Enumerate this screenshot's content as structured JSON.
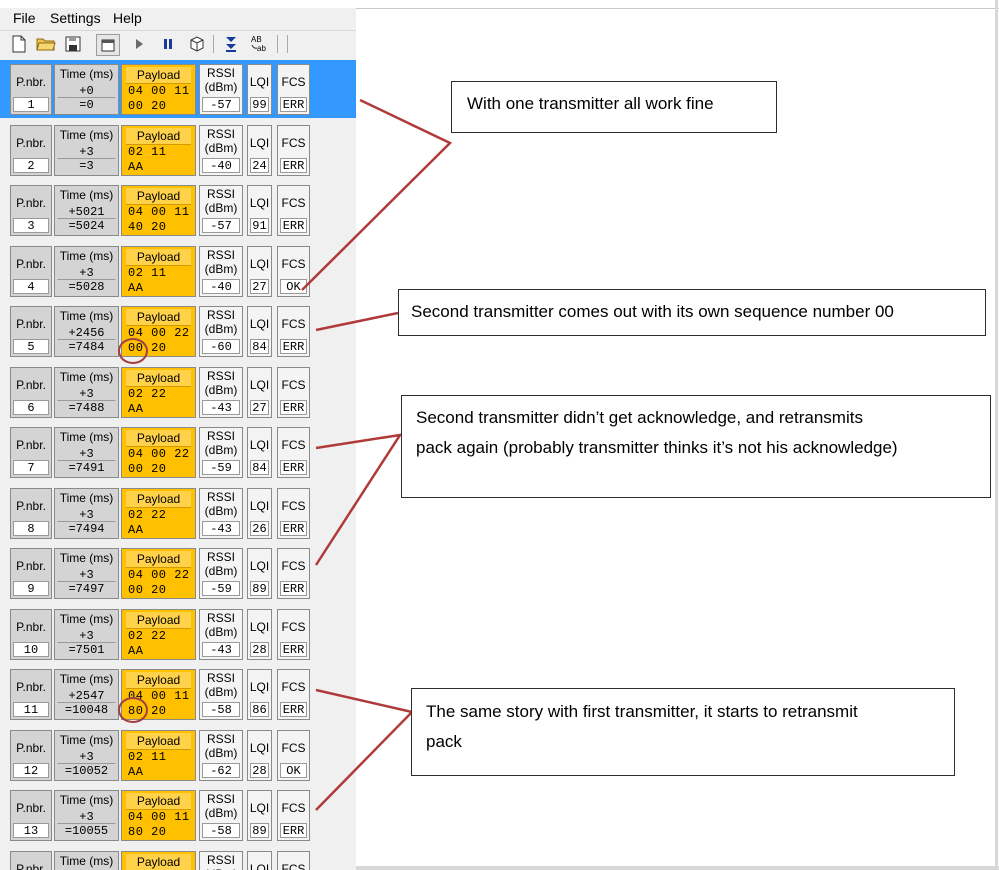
{
  "menu": [
    "File",
    "Settings",
    "Help"
  ],
  "toolbar_icons": [
    "new-file-icon",
    "open-folder-icon",
    "save-icon",
    "clipboard-icon",
    "play-icon",
    "pause-icon",
    "settings-box-icon",
    "scroll-down-icon",
    "ab-ab-icon"
  ],
  "headers": {
    "pnbr": "P.nbr.",
    "time": "Time (ms)",
    "payload": "Payload",
    "rssi1": "RSSI",
    "rssi2": "(dBm)",
    "lqi": "LQI",
    "fcs": "FCS"
  },
  "packets": [
    {
      "n": "1",
      "delta": "+0",
      "abs": "=0",
      "p1": "04 00 11",
      "p2": "00 20",
      "rssi": "-57",
      "lqi": "99",
      "fcs": "ERR",
      "selected": true
    },
    {
      "n": "2",
      "delta": "+3",
      "abs": "=3",
      "p1": "02 11",
      "p2": "AA",
      "rssi": "-40",
      "lqi": "24",
      "fcs": "ERR"
    },
    {
      "n": "3",
      "delta": "+5021",
      "abs": "=5024",
      "p1": "04 00 11",
      "p2": "40 20",
      "rssi": "-57",
      "lqi": "91",
      "fcs": "ERR"
    },
    {
      "n": "4",
      "delta": "+3",
      "abs": "=5028",
      "p1": "02 11",
      "p2": "AA",
      "rssi": "-40",
      "lqi": "27",
      "fcs": "OK"
    },
    {
      "n": "5",
      "delta": "+2456",
      "abs": "=7484",
      "p1": "04 00 22",
      "p2": "00 20",
      "rssi": "-60",
      "lqi": "84",
      "fcs": "ERR"
    },
    {
      "n": "6",
      "delta": "+3",
      "abs": "=7488",
      "p1": "02 22",
      "p2": "AA",
      "rssi": "-43",
      "lqi": "27",
      "fcs": "ERR"
    },
    {
      "n": "7",
      "delta": "+3",
      "abs": "=7491",
      "p1": "04 00 22",
      "p2": "00 20",
      "rssi": "-59",
      "lqi": "84",
      "fcs": "ERR"
    },
    {
      "n": "8",
      "delta": "+3",
      "abs": "=7494",
      "p1": "02 22",
      "p2": "AA",
      "rssi": "-43",
      "lqi": "26",
      "fcs": "ERR"
    },
    {
      "n": "9",
      "delta": "+3",
      "abs": "=7497",
      "p1": "04 00 22",
      "p2": "00 20",
      "rssi": "-59",
      "lqi": "89",
      "fcs": "ERR"
    },
    {
      "n": "10",
      "delta": "+3",
      "abs": "=7501",
      "p1": "02 22",
      "p2": "AA",
      "rssi": "-43",
      "lqi": "28",
      "fcs": "ERR"
    },
    {
      "n": "11",
      "delta": "+2547",
      "abs": "=10048",
      "p1": "04 00 11",
      "p2": "80 20",
      "rssi": "-58",
      "lqi": "86",
      "fcs": "ERR"
    },
    {
      "n": "12",
      "delta": "+3",
      "abs": "=10052",
      "p1": "02 11",
      "p2": "AA",
      "rssi": "-62",
      "lqi": "28",
      "fcs": "OK"
    },
    {
      "n": "13",
      "delta": "+3",
      "abs": "=10055",
      "p1": "04 00 11",
      "p2": "80 20",
      "rssi": "-58",
      "lqi": "89",
      "fcs": "ERR"
    },
    {
      "n": "",
      "delta": "",
      "abs": "",
      "p1": "",
      "p2": "",
      "rssi": "",
      "lqi": "",
      "fcs": "",
      "partial": true
    }
  ],
  "callouts": {
    "c1": {
      "line1": "With one transmitter all work fine"
    },
    "c2": {
      "line1": "Second transmitter comes out with its own sequence number 00"
    },
    "c3": {
      "line1": "Second transmitter didn’t get acknowledge, and retransmits",
      "line2": "pack again (probably transmitter thinks it’s not his acknowledge)"
    },
    "c4": {
      "line1": "The same story with first transmitter, it starts to retransmit",
      "line2": "pack"
    }
  },
  "colors": {
    "payload": "#ffc000",
    "selected": "#3399ff",
    "arrow": "#b03a3a"
  }
}
